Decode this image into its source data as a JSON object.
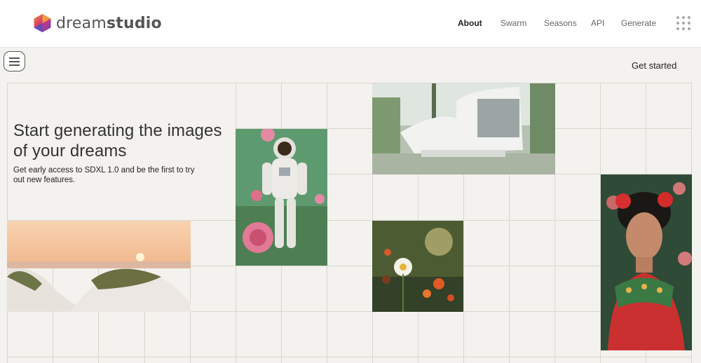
{
  "brand": {
    "name_light": "dream",
    "name_bold": "studio"
  },
  "nav": {
    "items": [
      {
        "label": "About",
        "active": true
      },
      {
        "label": "Swarm",
        "active": false
      },
      {
        "label": "Seasons",
        "active": false
      },
      {
        "label": "API",
        "active": false
      },
      {
        "label": "Generate",
        "active": false
      }
    ],
    "apps_icon": "grid-dots-icon",
    "menu_icon": "hamburger-menu-icon"
  },
  "header": {
    "cta_label": "Get started"
  },
  "hero": {
    "title": "Start generating the images of your dreams",
    "subtitle": "Get early access to SDXL 1.0 and be the first to try out new features."
  },
  "colors": {
    "background": "#f4f2ee",
    "grid_line": "#d9d6cf",
    "nav_active": "#222222",
    "nav_inactive": "#666666"
  }
}
